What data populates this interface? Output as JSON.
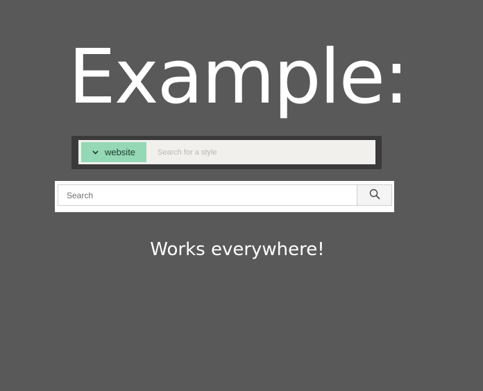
{
  "heading": {
    "title": "Example:",
    "subtitle": "Works everywhere!"
  },
  "search_bar_styled": {
    "dropdown_label": "website",
    "dropdown_icon": "chevron-down-icon",
    "placeholder": "Search for a style",
    "value": "",
    "colors": {
      "frame": "#3a3a3a",
      "field": "#f2f0ec",
      "dropdown": "#94d8b6"
    }
  },
  "search_bar_plain": {
    "placeholder": "Search",
    "value": "",
    "button_icon": "search-icon",
    "colors": {
      "frame": "#ffffff",
      "button": "#f4f4f4"
    }
  },
  "colors": {
    "background": "#595959",
    "text": "#ffffff"
  }
}
